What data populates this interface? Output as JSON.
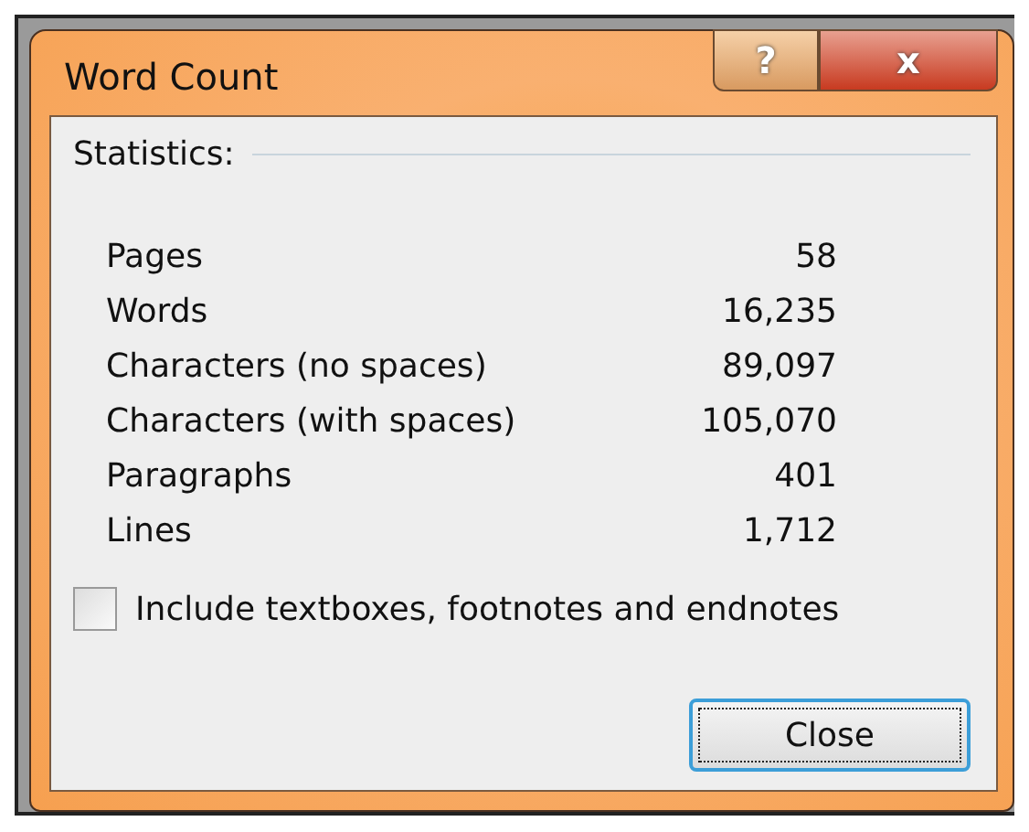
{
  "window": {
    "title": "Word Count",
    "help_button": "?",
    "close_button": "x"
  },
  "statistics": {
    "heading": "Statistics:",
    "rows": [
      {
        "label": "Pages",
        "value": "58"
      },
      {
        "label": "Words",
        "value": "16,235"
      },
      {
        "label": "Characters (no spaces)",
        "value": "89,097"
      },
      {
        "label": "Characters (with spaces)",
        "value": "105,070"
      },
      {
        "label": "Paragraphs",
        "value": "401"
      },
      {
        "label": "Lines",
        "value": "1,712"
      }
    ]
  },
  "include_checkbox": {
    "label": "Include textboxes, footnotes and endnotes",
    "checked": false
  },
  "buttons": [
    {
      "label": "Close",
      "focused": true
    }
  ]
}
